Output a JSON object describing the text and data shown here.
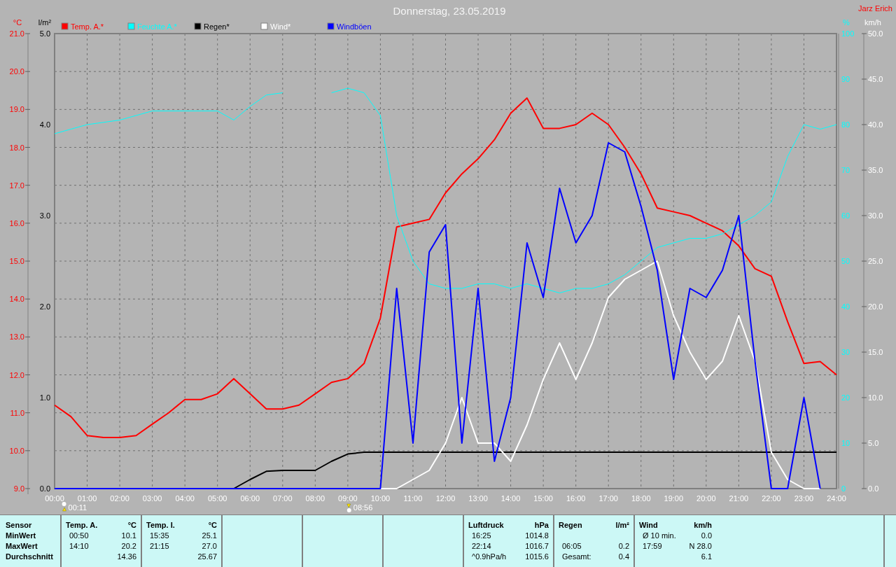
{
  "chart": {
    "title": "Donnerstag, 23.05.2019",
    "author": "Jarz Erich",
    "markers": [
      {
        "kind": "moonset",
        "time": "00:11"
      },
      {
        "kind": "moonrise",
        "time": "08:56"
      }
    ],
    "chart_data": {
      "type": "line",
      "grid": true,
      "legend": "top",
      "xlim": [
        0,
        24
      ],
      "ylabel": "°C",
      "y2label": "l/m²",
      "ylim": [
        9,
        21
      ],
      "y2lim": [
        0,
        5
      ],
      "yticks": [
        {
          "value": 21,
          "label": "21.0"
        },
        {
          "value": 20,
          "label": "20.0"
        },
        {
          "value": 19,
          "label": "19.0"
        },
        {
          "value": 18,
          "label": "18.0"
        },
        {
          "value": 17,
          "label": "17.0"
        },
        {
          "value": 16,
          "label": "16.0"
        },
        {
          "value": 15,
          "label": "15.0"
        },
        {
          "value": 14,
          "label": "14.0"
        },
        {
          "value": 13,
          "label": "13.0"
        },
        {
          "value": 12,
          "label": "12.0"
        },
        {
          "value": 11,
          "label": "11.0"
        },
        {
          "value": 10,
          "label": "10.0"
        },
        {
          "value": 9,
          "label": "9.0"
        }
      ],
      "y2ticks": [
        {
          "value": 5,
          "label": "5.0"
        },
        {
          "value": 4,
          "label": "4.0"
        },
        {
          "value": 3,
          "label": "3.0"
        },
        {
          "value": 2,
          "label": "2.0"
        },
        {
          "value": 1,
          "label": "1.0"
        },
        {
          "value": 0,
          "label": "0.0"
        }
      ],
      "x": [
        0,
        0.5,
        1,
        1.5,
        2,
        2.5,
        3,
        3.5,
        4,
        4.5,
        5,
        5.5,
        6,
        6.5,
        7,
        7.5,
        8,
        8.5,
        9,
        9.5,
        10,
        10.5,
        11,
        11.5,
        12,
        12.5,
        13,
        13.5,
        14,
        14.5,
        15,
        15.5,
        16,
        16.5,
        17,
        17.5,
        18,
        18.5,
        19,
        19.5,
        20,
        20.5,
        21,
        21.5,
        22,
        22.5,
        23,
        23.5,
        24
      ],
      "xticks": [
        {
          "value": 0,
          "label": "00:00"
        },
        {
          "value": 1,
          "label": "01:00"
        },
        {
          "value": 2,
          "label": "02:00"
        },
        {
          "value": 3,
          "label": "03:00"
        },
        {
          "value": 4,
          "label": "04:00"
        },
        {
          "value": 5,
          "label": "05:00"
        },
        {
          "value": 6,
          "label": "06:00"
        },
        {
          "value": 7,
          "label": "07:00"
        },
        {
          "value": 8,
          "label": "08:00"
        },
        {
          "value": 9,
          "label": "09:00"
        },
        {
          "value": 10,
          "label": "10:00"
        },
        {
          "value": 11,
          "label": "11:00"
        },
        {
          "value": 12,
          "label": "12:00"
        },
        {
          "value": 13,
          "label": "13:00"
        },
        {
          "value": 14,
          "label": "14:00"
        },
        {
          "value": 15,
          "label": "15:00"
        },
        {
          "value": 16,
          "label": "16:00"
        },
        {
          "value": 17,
          "label": "17:00"
        },
        {
          "value": 18,
          "label": "18:00"
        },
        {
          "value": 19,
          "label": "19:00"
        },
        {
          "value": 20,
          "label": "20:00"
        },
        {
          "value": 21,
          "label": "21:00"
        },
        {
          "value": 22,
          "label": "22:00"
        },
        {
          "value": 23,
          "label": "23:00"
        },
        {
          "value": 24,
          "label": "24:00"
        }
      ],
      "series": [
        {
          "name": "Temp. A.*",
          "color": "#ff0000",
          "values": [
            11.2,
            10.9,
            10.4,
            10.35,
            10.35,
            10.4,
            10.7,
            11.0,
            11.35,
            11.35,
            11.5,
            11.9,
            11.5,
            11.1,
            11.1,
            11.2,
            11.5,
            11.8,
            11.9,
            12.3,
            13.5,
            15.9,
            16.0,
            16.1,
            16.8,
            17.3,
            17.7,
            18.2,
            18.9,
            19.3,
            18.5,
            18.5,
            18.6,
            18.9,
            18.6,
            18.0,
            17.3,
            16.4,
            16.3,
            16.2,
            16.0,
            15.8,
            15.4,
            14.8,
            14.6,
            13.4,
            12.3,
            12.35,
            12.0
          ]
        },
        {
          "name": "Regen*",
          "color": "#000000",
          "axis": "y2",
          "values": [
            null,
            null,
            null,
            null,
            null,
            null,
            null,
            null,
            null,
            null,
            0,
            0,
            0.1,
            0.19,
            0.2,
            0.2,
            0.2,
            0.3,
            0.38,
            0.4,
            0.4,
            0.4,
            0.4,
            0.4,
            0.4,
            0.4,
            0.4,
            0.4,
            0.4,
            0.4,
            0.4,
            0.4,
            0.4,
            0.4,
            0.4,
            0.4,
            0.4,
            0.4,
            0.4,
            0.4,
            0.4,
            0.4,
            0.4,
            0.4,
            0.4,
            0.4,
            0.4,
            0.4,
            0.4
          ]
        }
      ]
    }
  },
  "wind_chart": {
    "chart_data": {
      "type": "line",
      "legend": "top",
      "xlim": [
        0,
        24
      ],
      "ylabel": "km/h",
      "y2label": "%",
      "ylim": [
        0,
        50
      ],
      "y2lim": [
        0,
        100
      ],
      "yticks": [
        {
          "value": 50,
          "label": "50.0"
        },
        {
          "value": 45,
          "label": "45.0"
        },
        {
          "value": 40,
          "label": "40.0"
        },
        {
          "value": 35,
          "label": "35.0"
        },
        {
          "value": 30,
          "label": "30.0"
        },
        {
          "value": 25,
          "label": "25.0"
        },
        {
          "value": 20,
          "label": "20.0"
        },
        {
          "value": 15,
          "label": "15.0"
        },
        {
          "value": 10,
          "label": "10.0"
        },
        {
          "value": 5,
          "label": "5.0"
        },
        {
          "value": 0,
          "label": "0.0"
        }
      ],
      "y2ticks": [
        100,
        90,
        80,
        70,
        60,
        50,
        40,
        30,
        20,
        10,
        0
      ],
      "x": [
        0,
        0.5,
        1,
        1.5,
        2,
        2.5,
        3,
        3.5,
        4,
        4.5,
        5,
        5.5,
        6,
        6.5,
        7,
        7.5,
        8,
        8.5,
        9,
        9.5,
        10,
        10.5,
        11,
        11.5,
        12,
        12.5,
        13,
        13.5,
        14,
        14.5,
        15,
        15.5,
        16,
        16.5,
        17,
        17.5,
        18,
        18.5,
        19,
        19.5,
        20,
        20.5,
        21,
        21.5,
        22,
        22.5,
        23,
        23.5,
        24
      ],
      "series": [
        {
          "name": "Feuchte A.*",
          "color": "#00ffff",
          "axis": "y2",
          "values": [
            78,
            79,
            80,
            80.5,
            81,
            82,
            83,
            83,
            83,
            83,
            83,
            81,
            84,
            86.5,
            87,
            null,
            null,
            87,
            88,
            87,
            82,
            60,
            50,
            45,
            44,
            44,
            45,
            45,
            44,
            45,
            44,
            43,
            44,
            44,
            45,
            47,
            50,
            53,
            54,
            55,
            55,
            56,
            58,
            60,
            63,
            73,
            80,
            79,
            80
          ]
        },
        {
          "name": "Wind*",
          "color": "#ffffff",
          "values": [
            null,
            null,
            null,
            null,
            null,
            null,
            null,
            null,
            null,
            null,
            null,
            null,
            null,
            null,
            null,
            null,
            null,
            null,
            null,
            0,
            0,
            0,
            1,
            2,
            5,
            10,
            5,
            5,
            3,
            7,
            12,
            16,
            12,
            16,
            21,
            23,
            24,
            25,
            19,
            15,
            12,
            14,
            19,
            14,
            4,
            1,
            0,
            0,
            null
          ]
        },
        {
          "name": "Windböen",
          "color": "#0000ff",
          "values": [
            0,
            0,
            0,
            0,
            0,
            0,
            0,
            0,
            0,
            0,
            0,
            0,
            0,
            0,
            0,
            0,
            0,
            0,
            0,
            0,
            0,
            22,
            5,
            26,
            29,
            5,
            22,
            3,
            10,
            27,
            21,
            33,
            27,
            30,
            38,
            37,
            31,
            24,
            12,
            22,
            21,
            24,
            30,
            14,
            0,
            0,
            10,
            0,
            null
          ]
        }
      ]
    }
  },
  "stats": {
    "row_labels": [
      "Sensor",
      "MinWert",
      "MaxWert",
      "Durchschnitt"
    ],
    "panels": [
      {
        "kind": "sensor",
        "title": "Temp. A.",
        "unit": "°C",
        "rows": [
          [
            "00:50",
            "10.1"
          ],
          [
            "14:10",
            "20.2"
          ],
          [
            null,
            "14.36"
          ]
        ]
      },
      {
        "kind": "sensor",
        "title": "Temp. I.",
        "unit": "°C",
        "rows": [
          [
            "15:35",
            "25.1"
          ],
          [
            "21:15",
            "27.0"
          ],
          [
            null,
            "25.67"
          ]
        ]
      },
      {
        "kind": "empty"
      },
      {
        "kind": "empty"
      },
      {
        "kind": "empty"
      },
      {
        "kind": "sensor",
        "title": "Luftdruck",
        "unit": "hPa",
        "rows": [
          [
            "16:25",
            "1014.8"
          ],
          [
            "22:14",
            "1016.7"
          ],
          [
            "^0.9hPa/h",
            "1015.6"
          ]
        ]
      },
      {
        "kind": "sensor",
        "title": "Regen",
        "unit": "l/m²",
        "rows": [
          [
            null,
            null
          ],
          [
            "06:05",
            "0.2"
          ],
          [
            "Gesamt:",
            "0.4"
          ]
        ]
      },
      {
        "kind": "wide",
        "title": "Wind",
        "unit": "km/h",
        "rows": [
          [
            "Ø 10 min.",
            "0.0"
          ],
          [
            "17:59",
            "N 28.0"
          ],
          [
            null,
            "6.1"
          ]
        ]
      }
    ]
  }
}
